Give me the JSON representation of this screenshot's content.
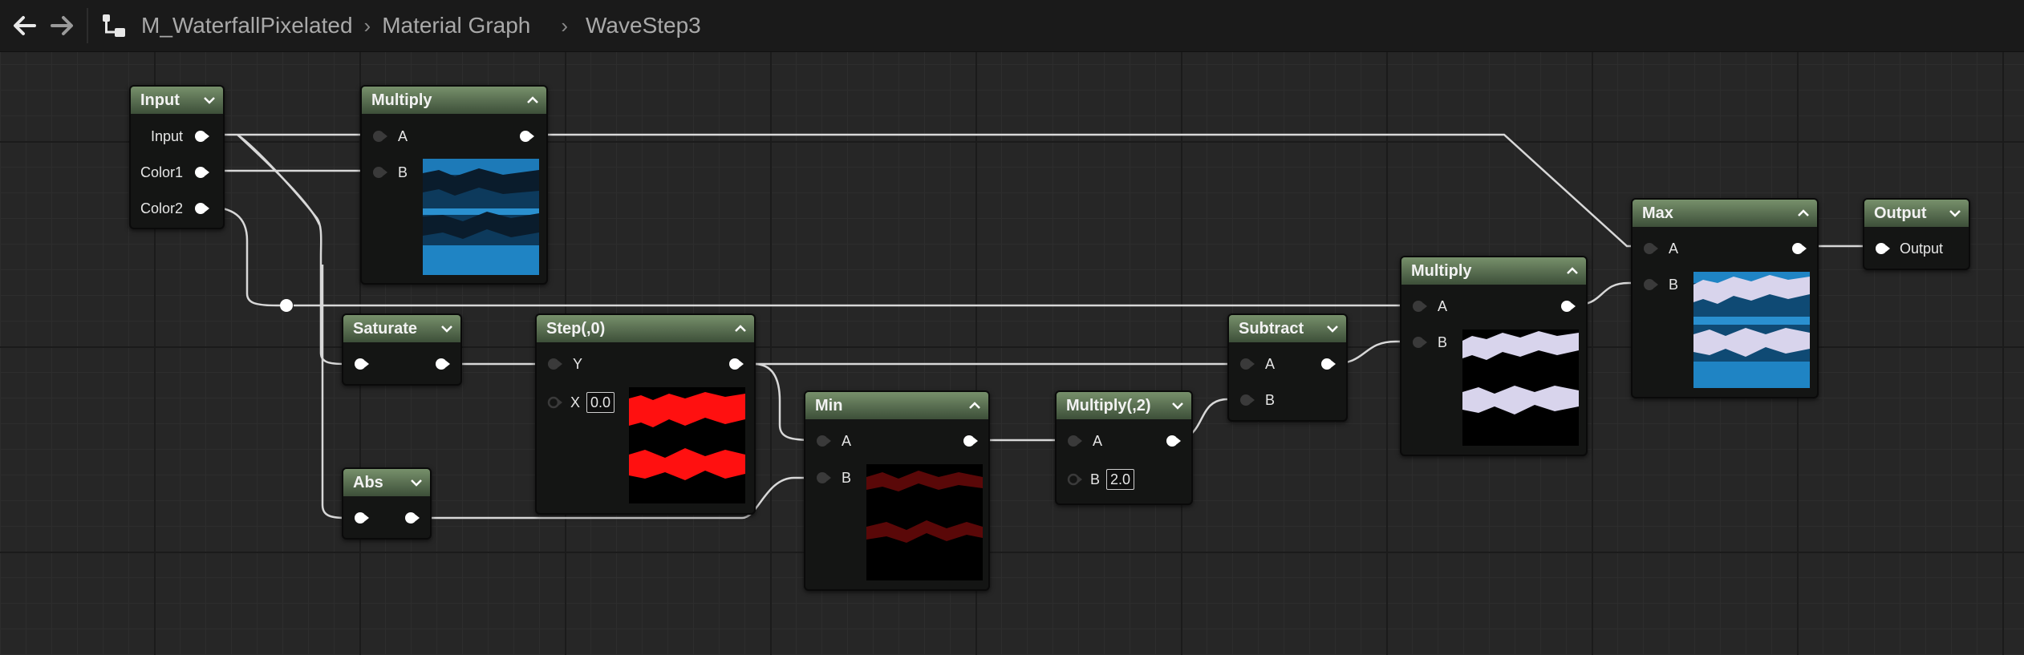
{
  "toolbar": {
    "back_icon": "arrow-left-icon",
    "forward_icon": "arrow-right-icon",
    "graph_icon": "material-graph-icon",
    "breadcrumbs": [
      "M_WaterfallPixelated",
      "Material Graph",
      "WaveStep3"
    ]
  },
  "colors": {
    "node_header_top": "#77906b",
    "node_header_bottom": "#3d4f39",
    "node_body": "#141514",
    "wire": "#d8d8d8",
    "pin_connected": "#ffffff",
    "pin_disconnected": "#3a3a3a"
  },
  "nodes": {
    "input": {
      "title": "Input",
      "pins": [
        "Input",
        "Color1",
        "Color2"
      ]
    },
    "multiply_top": {
      "title": "Multiply",
      "pin_a": "A",
      "pin_b": "B"
    },
    "saturate": {
      "title": "Saturate"
    },
    "abs": {
      "title": "Abs"
    },
    "step": {
      "title": "Step(,0)",
      "pin_y": "Y",
      "pin_x": "X",
      "x_value": "0.0"
    },
    "min": {
      "title": "Min",
      "pin_a": "A",
      "pin_b": "B"
    },
    "multiply2": {
      "title": "Multiply(,2)",
      "pin_a": "A",
      "pin_b": "B",
      "b_value": "2.0"
    },
    "subtract": {
      "title": "Subtract",
      "pin_a": "A",
      "pin_b": "B"
    },
    "multiply_right": {
      "title": "Multiply",
      "pin_a": "A",
      "pin_b": "B"
    },
    "max": {
      "title": "Max",
      "pin_a": "A",
      "pin_b": "B"
    },
    "output": {
      "title": "Output",
      "pin": "Output"
    }
  }
}
